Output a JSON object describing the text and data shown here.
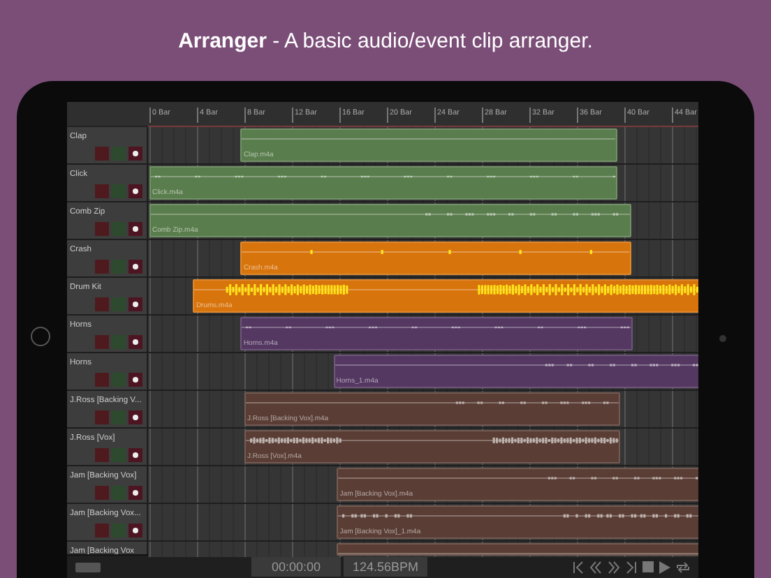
{
  "caption": "**Arranger** - A basic audio/event clip arranger.",
  "ruler": [
    "0 Bar",
    "4 Bar",
    "8 Bar",
    "12 Bar",
    "16 Bar",
    "20 Bar",
    "24 Bar",
    "28 Bar",
    "32 Bar",
    "36 Bar",
    "40 Bar",
    "44 Bar"
  ],
  "tracks": [
    {
      "name": "Clap",
      "clip": {
        "file": "Clap.m4a",
        "color": "#5a7d4d"
      }
    },
    {
      "name": "Click",
      "clip": {
        "file": "Click.m4a",
        "color": "#5a7d4d"
      }
    },
    {
      "name": "Comb Zip",
      "clip": {
        "file": "Comb Zip.m4a",
        "color": "#5a7d4d"
      }
    },
    {
      "name": "Crash",
      "clip": {
        "file": "Crash.m4a",
        "color": "#d8740c"
      }
    },
    {
      "name": "Drum Kit",
      "clip": {
        "file": "Drums.m4a",
        "color": "#d8740c"
      }
    },
    {
      "name": "Horns",
      "clip": {
        "file": "Horns.m4a",
        "color": "#543862"
      }
    },
    {
      "name": "Horns",
      "clip": {
        "file": "Horns_1.m4a",
        "color": "#543862"
      }
    },
    {
      "name": "J.Ross [Backing V...",
      "clip": {
        "file": "J.Ross [Backing Vox].m4a",
        "color": "#5a3e35"
      }
    },
    {
      "name": "J.Ross [Vox]",
      "clip": {
        "file": "J.Ross [Vox].m4a",
        "color": "#5a3e35"
      }
    },
    {
      "name": "Jam [Backing Vox]",
      "clip": {
        "file": "Jam [Backing Vox].m4a",
        "color": "#5a3e35"
      }
    },
    {
      "name": "Jam [Backing Vox...",
      "clip": {
        "file": "Jam [Backing Vox]_1.m4a",
        "color": "#5a3e35"
      }
    },
    {
      "name": "Jam [Backing Vox",
      "clip": {
        "color": "#5a3e35"
      }
    }
  ],
  "transport": {
    "time": "00:00:00",
    "tempo": "124.56BPM"
  }
}
